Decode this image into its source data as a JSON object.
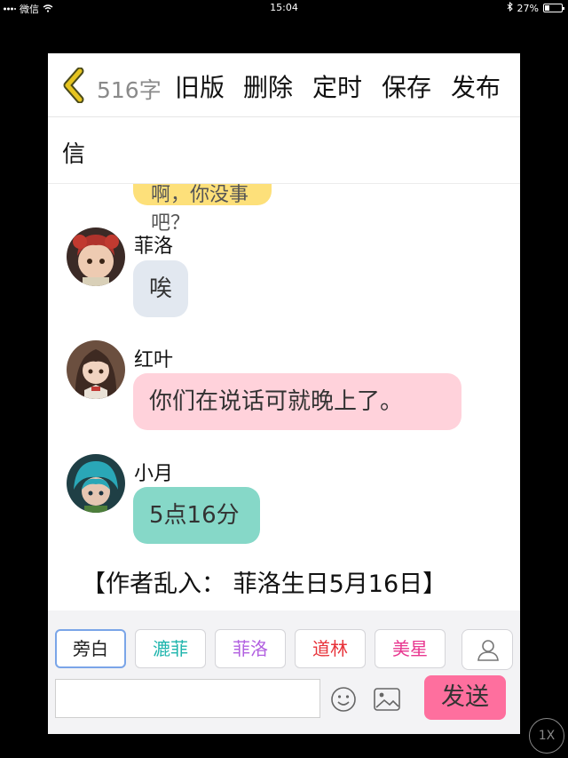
{
  "status_bar": {
    "carrier": "微信",
    "time": "15:04",
    "battery": "27%"
  },
  "toolbar": {
    "char_count": "516字",
    "buttons": [
      "旧版",
      "删除",
      "定时",
      "保存",
      "发布"
    ]
  },
  "title": "信",
  "chat": {
    "partial_bubble_text": "啊，你没事吧？",
    "messages": [
      {
        "sender": "菲洛",
        "text": "唉",
        "bubble_color": "#e2e8f0"
      },
      {
        "sender": "红叶",
        "text": "你们在说话可就晚上了。",
        "bubble_color": "#ffd2db"
      },
      {
        "sender": "小月",
        "text": "5点16分",
        "bubble_color": "#86d8c8"
      }
    ],
    "narration": "【作者乱入：  菲洛生日5月16日】"
  },
  "characters": [
    {
      "name": "旁白",
      "color": "#222222"
    },
    {
      "name": "漉菲",
      "color": "#1fb5ad"
    },
    {
      "name": "菲洛",
      "color": "#b15fe0"
    },
    {
      "name": "道林",
      "color": "#e8333a"
    },
    {
      "name": "美星",
      "color": "#e8368f"
    }
  ],
  "composer": {
    "send_label": "发送",
    "input_value": ""
  },
  "zoom": "1X",
  "icons": {
    "back": "chevron-left-icon",
    "person": "person-icon",
    "emoji": "emoji-icon",
    "image": "image-icon"
  },
  "colors": {
    "accent": "#e2c21b",
    "send": "#fe6f9e"
  }
}
